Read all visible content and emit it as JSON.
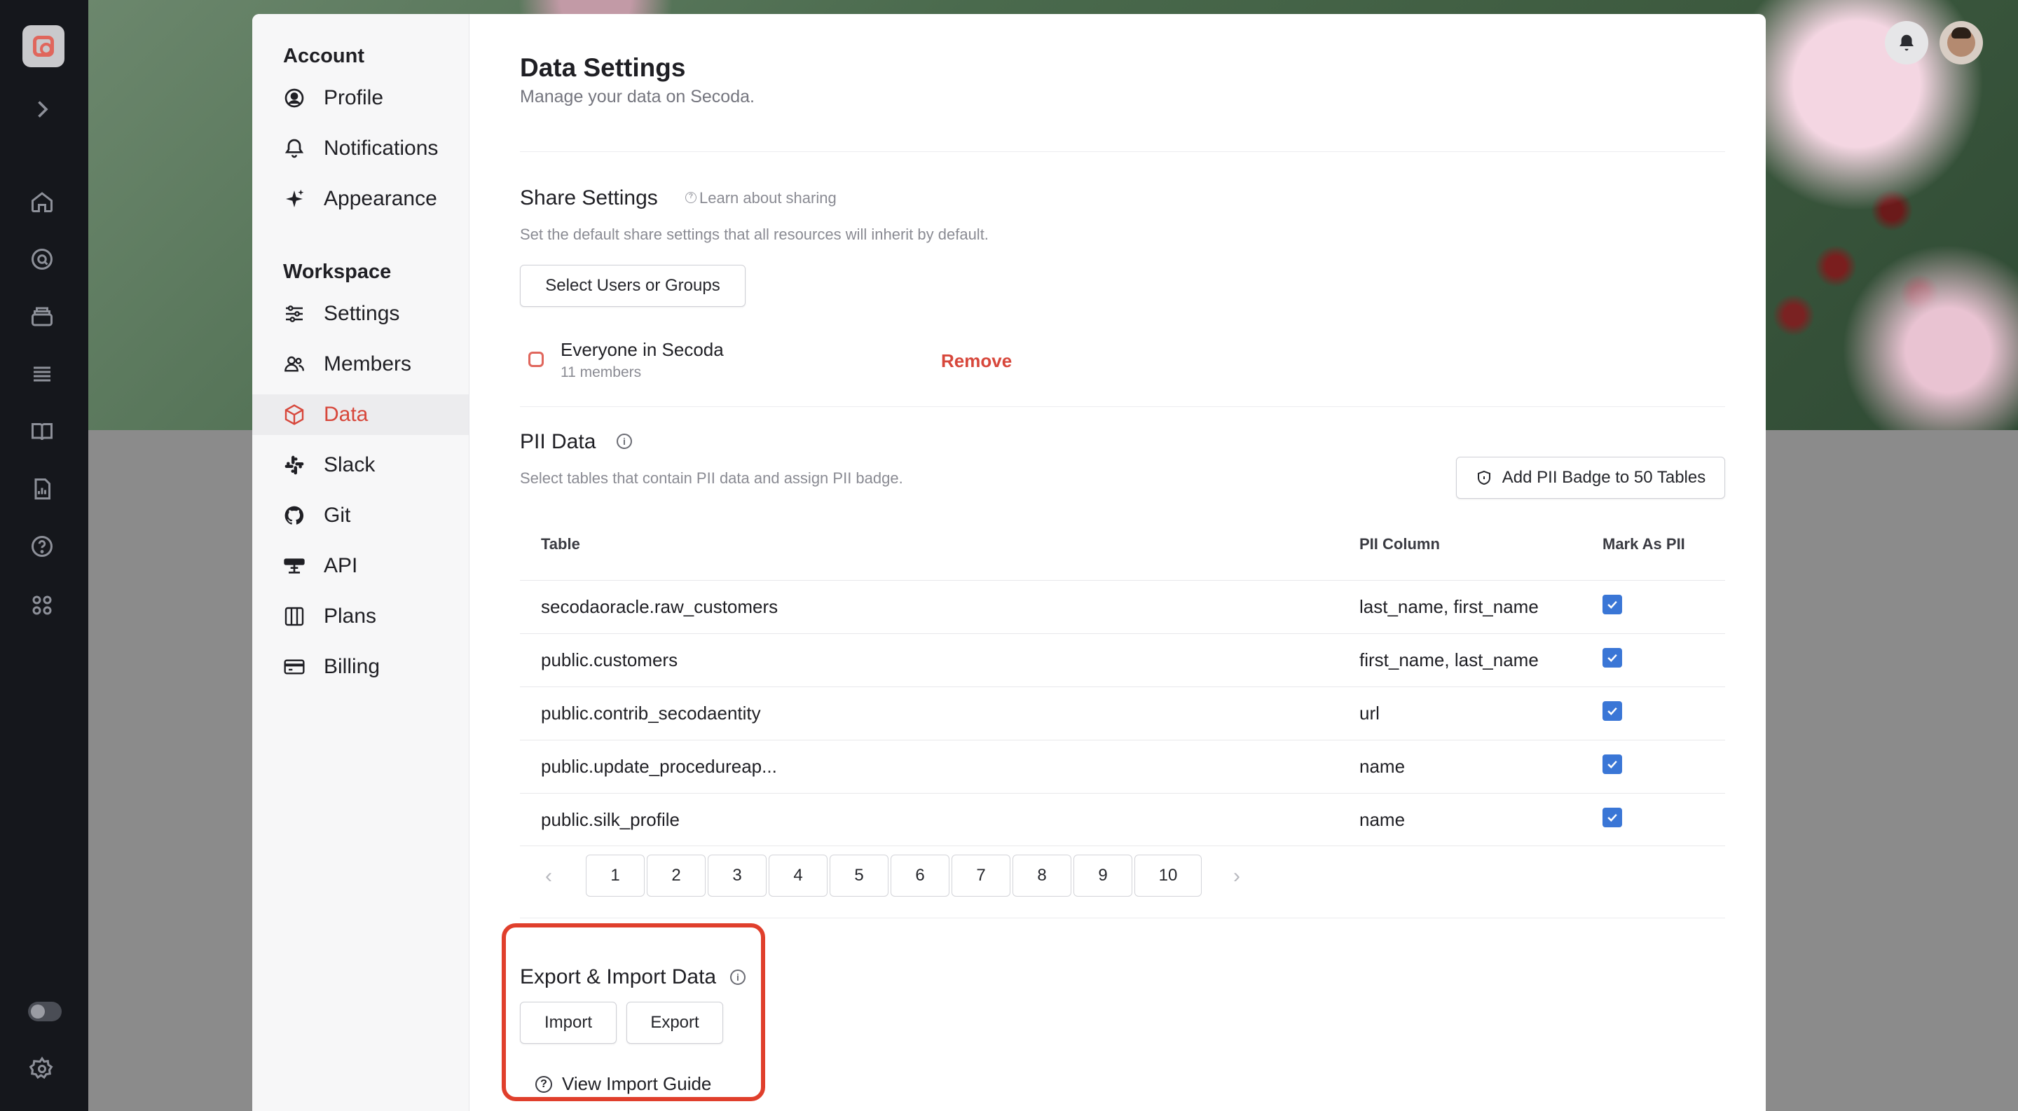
{
  "sidebar": {
    "account_heading": "Account",
    "workspace_heading": "Workspace",
    "account_items": [
      {
        "label": "Profile",
        "icon": "user-circle-icon"
      },
      {
        "label": "Notifications",
        "icon": "bell-icon"
      },
      {
        "label": "Appearance",
        "icon": "sparkle-icon"
      }
    ],
    "workspace_items": [
      {
        "label": "Settings",
        "icon": "sliders-icon"
      },
      {
        "label": "Members",
        "icon": "users-icon"
      },
      {
        "label": "Data",
        "icon": "cube-icon",
        "active": true
      },
      {
        "label": "Slack",
        "icon": "slack-icon"
      },
      {
        "label": "Git",
        "icon": "github-icon"
      },
      {
        "label": "API",
        "icon": "api-icon"
      },
      {
        "label": "Plans",
        "icon": "map-icon"
      },
      {
        "label": "Billing",
        "icon": "credit-card-icon"
      }
    ]
  },
  "page": {
    "title": "Data Settings",
    "subtitle": "Manage your data on Secoda."
  },
  "share": {
    "title": "Share Settings",
    "learn_link": "Learn about sharing",
    "description": "Set the default share settings that all resources will inherit by default.",
    "select_button": "Select Users or Groups",
    "member_name": "Everyone in Secoda",
    "member_count": "11 members",
    "remove_label": "Remove"
  },
  "pii": {
    "title": "PII Data",
    "description": "Select tables that contain PII data and assign PII badge.",
    "badge_button": "Add PII Badge to 50 Tables",
    "columns": [
      "Table",
      "PII Column",
      "Mark As PII"
    ],
    "rows": [
      {
        "table": "secodaoracle.raw_customers",
        "pii_column": "last_name, first_name",
        "checked": true
      },
      {
        "table": "public.customers",
        "pii_column": "first_name, last_name",
        "checked": true
      },
      {
        "table": "public.contrib_secodaentity",
        "pii_column": "url",
        "checked": true
      },
      {
        "table": "public.update_procedureap...",
        "pii_column": "name",
        "checked": true
      },
      {
        "table": "public.silk_profile",
        "pii_column": "name",
        "checked": true
      }
    ],
    "pages": [
      "1",
      "2",
      "3",
      "4",
      "5",
      "6",
      "7",
      "8",
      "9",
      "10"
    ],
    "prev_label": "‹",
    "next_label": "›"
  },
  "export_import": {
    "title": "Export & Import Data",
    "import_button": "Import",
    "export_button": "Export",
    "guide_link": "View Import Guide"
  },
  "colors": {
    "accent": "#d7473b",
    "highlight_border": "#e03f2c",
    "checkbox": "#3a76d6"
  }
}
